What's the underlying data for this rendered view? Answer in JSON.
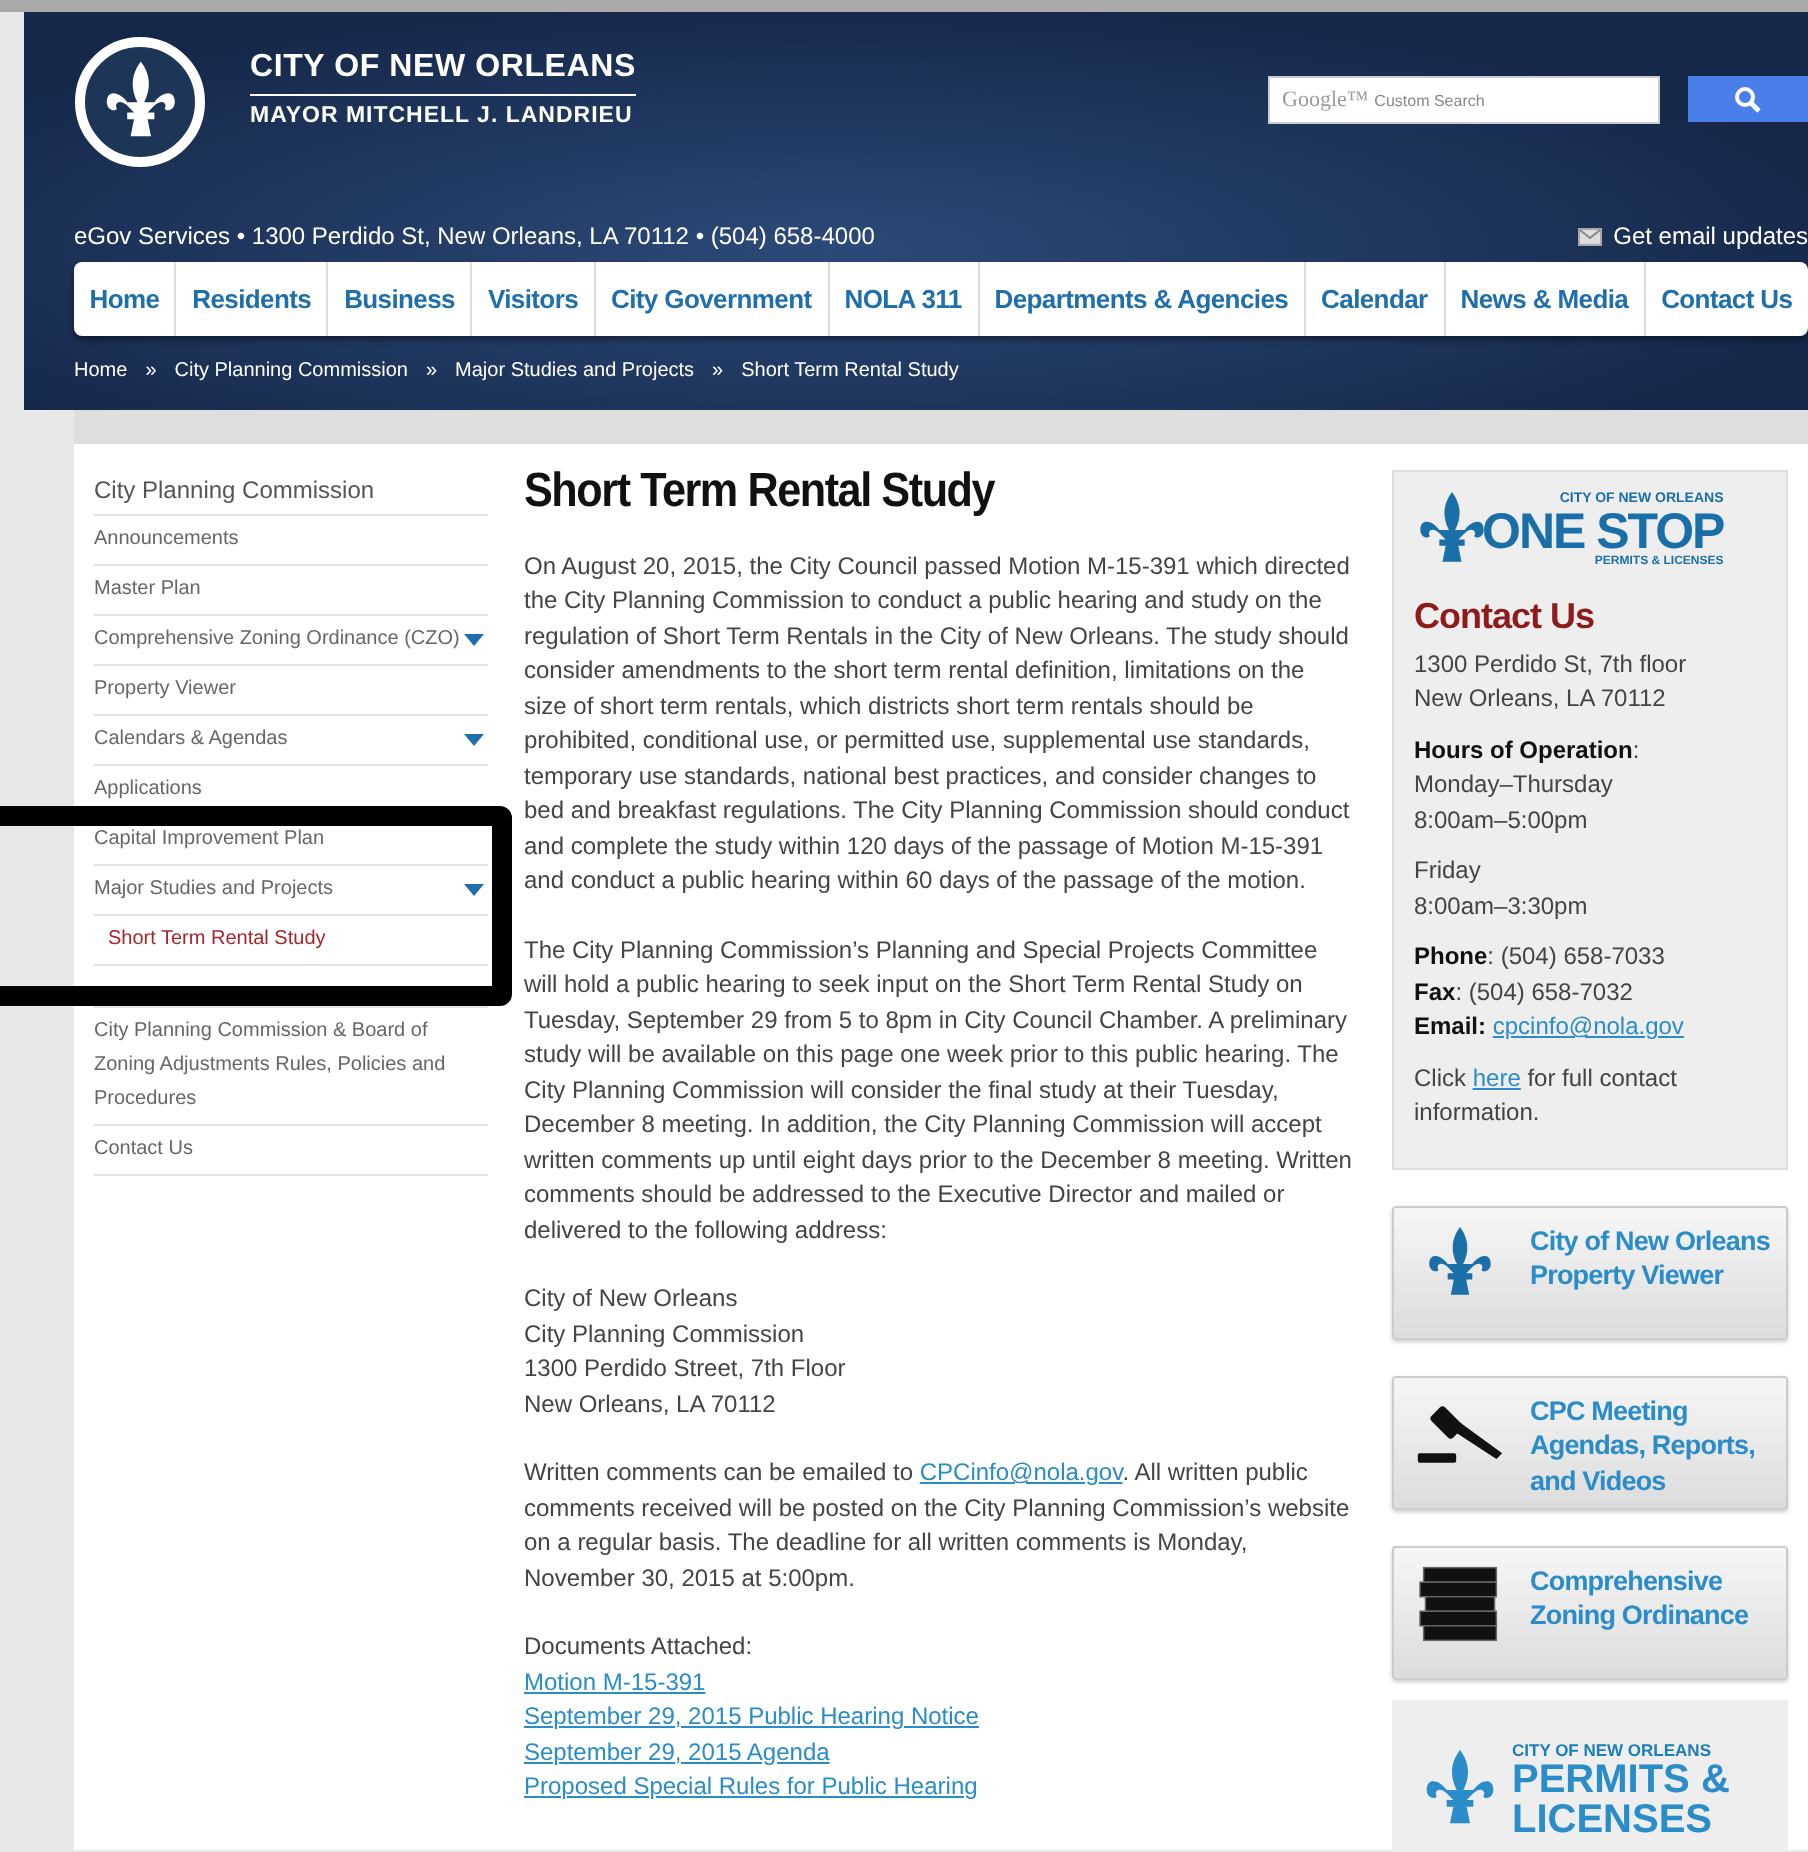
{
  "header": {
    "title": "CITY OF NEW ORLEANS",
    "subtitle": "MAYOR MITCHELL J. LANDRIEU",
    "search": {
      "brand": "Google™",
      "placeholder": "Custom Search"
    },
    "info": "eGov Services • 1300 Perdido St, New Orleans, LA 70112 • (504) 658-4000",
    "email_updates": "Get email updates"
  },
  "nav": [
    "Home",
    "Residents",
    "Business",
    "Visitors",
    "City Government",
    "NOLA 311",
    "Departments & Agencies",
    "Calendar",
    "News & Media",
    "Contact Us"
  ],
  "breadcrumb": {
    "separator": "»",
    "items": [
      "Home",
      "City Planning Commission",
      "Major Studies and Projects",
      "Short Term Rental Study"
    ]
  },
  "sidebar": {
    "title": "City Planning Commission",
    "items": [
      {
        "label": "Announcements",
        "expandable": false,
        "selected": false
      },
      {
        "label": "Master Plan",
        "expandable": false,
        "selected": false
      },
      {
        "label": "Comprehensive Zoning Ordinance (CZO)",
        "expandable": true,
        "selected": false
      },
      {
        "label": "Property Viewer",
        "expandable": false,
        "selected": false
      },
      {
        "label": "Calendars & Agendas",
        "expandable": true,
        "selected": false
      },
      {
        "label": "Applications",
        "expandable": false,
        "selected": false
      },
      {
        "label": "Capital Improvement Plan",
        "expandable": false,
        "selected": false
      },
      {
        "label": "Major Studies and Projects",
        "expandable": true,
        "selected": false,
        "children": [
          {
            "label": "Short Term Rental Study",
            "selected": true
          }
        ]
      },
      {
        "kind": "hidden"
      },
      {
        "label": "City Planning Commission & Board of Zoning Adjustments Rules, Policies and Procedures",
        "expandable": false,
        "selected": false
      },
      {
        "label": "Contact Us",
        "expandable": false,
        "selected": false
      }
    ]
  },
  "main": {
    "title": "Short Term Rental Study",
    "blocks": [
      {
        "kind": "paragraph",
        "text": "On August 20, 2015, the City Council passed Motion M-15-391 which directed the City Planning Commission to conduct a public hearing and study on the regulation of Short Term Rentals in the City of New Orleans. The study should consider amendments to the short term rental definition, limitations on the size of short term rentals, which districts short term rentals should be prohibited, conditional use, or permitted use, supplemental use standards, temporary use standards, national best practices, and consider changes to bed and breakfast regulations. The City Planning Commission should conduct and complete the study within 120 days of the passage of Motion M-15-391 and conduct a public hearing within 60 days of the passage of the motion."
      },
      {
        "kind": "paragraph",
        "text": "The City Planning Commission’s Planning and Special Projects Committee will hold a public hearing to seek input on the Short Term Rental Study on Tuesday, September 29 from 5 to 8pm in City Council Chamber. A preliminary study will be available on this page one week prior to this public hearing. The City Planning Commission will consider the final study at their Tuesday, December 8 meeting. In addition, the City Planning Commission will accept written comments up until eight days prior to the December 8 meeting. Written comments should be addressed to the Executive Director and mailed or delivered to the following address:"
      },
      {
        "kind": "lines",
        "lines": [
          "City of New Orleans",
          "City Planning Commission",
          "1300 Perdido Street, 7th Floor",
          "New Orleans, LA 70112"
        ]
      },
      {
        "kind": "linked",
        "before": "Written comments can be emailed to ",
        "link": "CPCinfo@nola.gov",
        "after": ". All written public comments received will be posted on the City Planning Commission’s website on a regular basis. The deadline for all written comments is Monday, November 30, 2015 at 5:00pm."
      },
      {
        "kind": "links",
        "heading": "Documents Attached:",
        "links": [
          "Motion M-15-391",
          "September 29, 2015 Public Hearing Notice",
          "September 29, 2015 Agenda",
          "Proposed Special Rules for Public Hearing"
        ]
      }
    ]
  },
  "contact": {
    "logo": {
      "top": "CITY OF NEW ORLEANS",
      "main": "ONE STOP",
      "bottom": "PERMITS & LICENSES"
    },
    "title": "Contact Us",
    "address": [
      "1300 Perdido St, 7th floor",
      "New Orleans, LA 70112"
    ],
    "hours_label": "**Hours of Operation**:",
    "hours": [
      [
        "Monday–Thursday",
        "8:00am–5:00pm"
      ],
      [
        "Friday",
        "8:00am–3:30pm"
      ]
    ],
    "phone": "**Phone**: (504) 658-7033",
    "fax": "**Fax**: (504) 658-7032",
    "email_label": "Email:",
    "email": "cpcinfo@nola.gov",
    "click_before": "Click ",
    "click_link": "here",
    "click_after": " for full contact information."
  },
  "tiles": [
    {
      "text": "City of New Orleans Property Viewer"
    },
    {
      "text": "CPC Meeting Agendas, Reports, and Videos"
    },
    {
      "text": "Comprehensive Zoning Ordinance"
    }
  ],
  "permits_logo": {
    "top": "CITY OF NEW ORLEANS",
    "main": "PERMITS & LICENSES"
  }
}
